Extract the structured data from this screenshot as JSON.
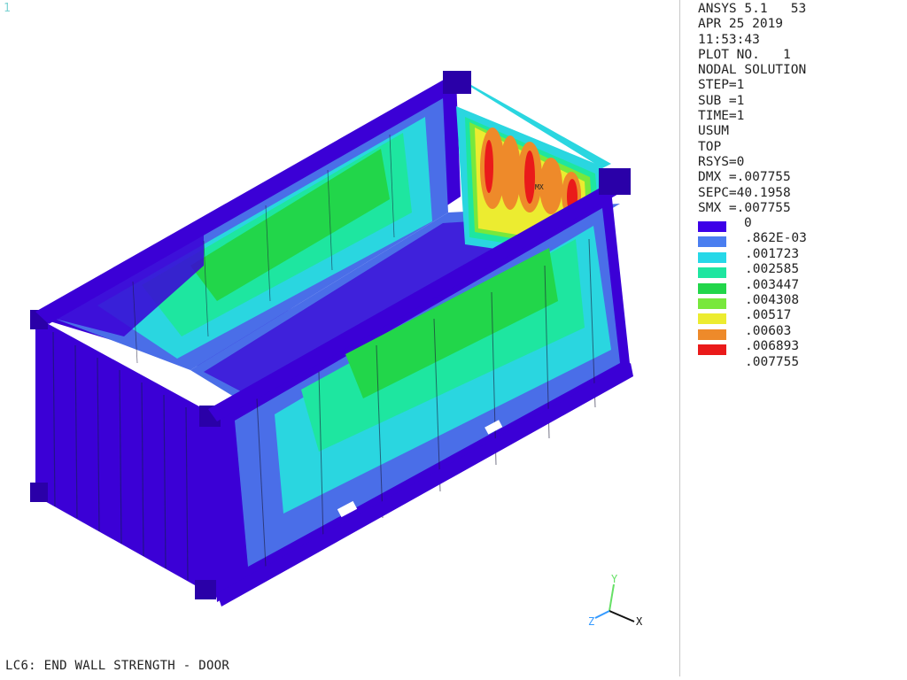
{
  "window_number": "1",
  "caption": "LC6: END WALL STRENGTH - DOOR",
  "info_lines": [
    "ANSYS 5.1   53",
    "APR 25 2019",
    "11:53:43",
    "PLOT NO.   1",
    "NODAL SOLUTION",
    "STEP=1",
    "SUB =1",
    "TIME=1",
    "USUM",
    "TOP",
    "RSYS=0",
    "DMX =.007755",
    "SEPC=40.1958",
    "SMX =.007755"
  ],
  "legend": {
    "min_label": "0",
    "levels": [
      {
        "color": "#3d00e8",
        "label": ".862E-03"
      },
      {
        "color": "#4a7ef0",
        "label": ".001723"
      },
      {
        "color": "#26d8e8",
        "label": ".002585"
      },
      {
        "color": "#1ee6a0",
        "label": ".003447"
      },
      {
        "color": "#22d64a",
        "label": ".004308"
      },
      {
        "color": "#78e83c",
        "label": ".00517"
      },
      {
        "color": "#ecec30",
        "label": ".00603"
      },
      {
        "color": "#ee8a2a",
        "label": ".006893"
      },
      {
        "color": "#ea1a1a",
        "label": ".007755"
      }
    ]
  },
  "triad": {
    "x_label": "X",
    "y_label": "Y",
    "z_label": "Z"
  },
  "max_marker": "MX",
  "colors": {
    "frame": "#3b00d6",
    "frame_dark": "#2a00a8",
    "blue": "#4a6ee8",
    "cyan": "#2ad6e0",
    "teal": "#1ee6a0",
    "green": "#22d64a",
    "yellow": "#ecec30",
    "orange": "#ee8a2a",
    "red": "#ea1a1a"
  }
}
